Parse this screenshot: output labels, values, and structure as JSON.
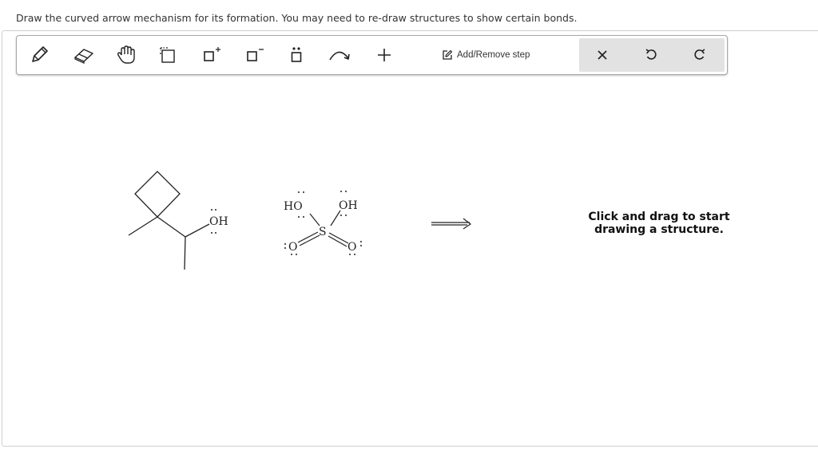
{
  "instruction": "Draw the curved arrow mechanism for its formation. You may need to re-draw structures to show certain bonds.",
  "toolbar": {
    "tools": [
      {
        "name": "pencil-icon"
      },
      {
        "name": "eraser-icon"
      },
      {
        "name": "hand-icon"
      },
      {
        "name": "selection-icon"
      },
      {
        "name": "positive-charge-icon"
      },
      {
        "name": "negative-charge-icon"
      },
      {
        "name": "lone-pair-icon"
      },
      {
        "name": "curved-arrow-icon"
      },
      {
        "name": "plus-icon"
      }
    ],
    "add_remove_step_label": "Add/Remove step",
    "add_remove_step_icon": "edit-icon",
    "actions": [
      {
        "name": "clear-icon"
      },
      {
        "name": "undo-icon"
      },
      {
        "name": "redo-icon"
      }
    ]
  },
  "molecules": {
    "alcohol_oh": "OH",
    "acid_ho": "HO",
    "acid_oh": "OH",
    "acid_s": "S",
    "acid_o_left": "O",
    "acid_o_right": "O"
  },
  "hint_line1": "Click and drag to start",
  "hint_line2": "drawing a structure.",
  "colors": {
    "toolbar_border": "#a8a8a8",
    "action_group_bg": "#e2e2e2",
    "icon": "#222222"
  }
}
